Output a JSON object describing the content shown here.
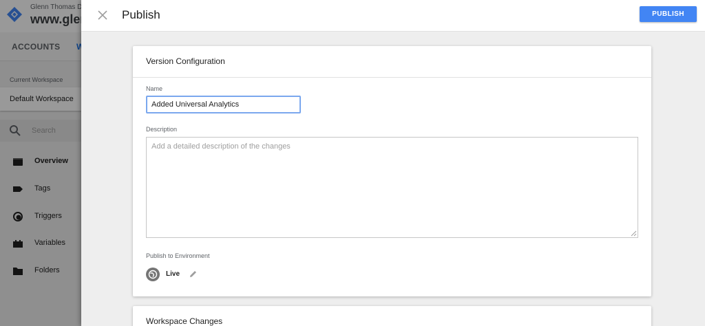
{
  "background": {
    "account_name": "Glenn Thomas D",
    "container_name": "www.glen",
    "tabs": [
      {
        "label": "ACCOUNTS"
      },
      {
        "label": "W"
      }
    ],
    "current_workspace_label": "Current Workspace",
    "current_workspace_value": "Default Workspace",
    "search_placeholder": "Search",
    "nav_items": [
      {
        "label": "Overview",
        "icon": "overview-icon",
        "active": true
      },
      {
        "label": "Tags",
        "icon": "tag-icon",
        "active": false
      },
      {
        "label": "Triggers",
        "icon": "trigger-icon",
        "active": false
      },
      {
        "label": "Variables",
        "icon": "variables-icon",
        "active": false
      },
      {
        "label": "Folders",
        "icon": "folder-icon",
        "active": false
      }
    ]
  },
  "publish_panel": {
    "title": "Publish",
    "publish_button": "PUBLISH",
    "close_icon": "close-icon",
    "version_config": {
      "title": "Version Configuration",
      "name_label": "Name",
      "name_value": "Added Universal Analytics",
      "description_label": "Description",
      "description_placeholder": "Add a detailed description of the changes",
      "description_value": "",
      "environment_label": "Publish to Environment",
      "environment_value": "Live"
    },
    "workspace_changes": {
      "title": "Workspace Changes"
    }
  },
  "colors": {
    "accent": "#4285f4",
    "focus_border": "#7aa7ee",
    "panel_bg": "#eeeeee"
  }
}
